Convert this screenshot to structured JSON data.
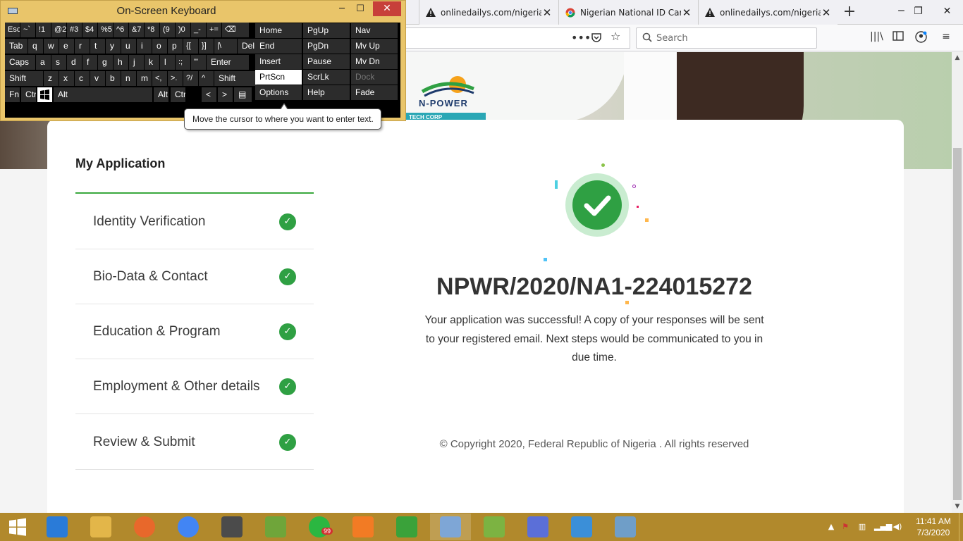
{
  "browser": {
    "tabs": [
      {
        "title": "onlinedailys.com/nigerian",
        "icon": "warning-icon"
      },
      {
        "title": "Nigerian National ID Card",
        "icon": "chrome-favicon-icon"
      },
      {
        "title": "onlinedailys.com/nigerian",
        "icon": "warning-icon"
      }
    ],
    "new_tab_label": "+",
    "search_placeholder": "Search",
    "window_controls": {
      "minimize": "─",
      "maximize": "❐",
      "close": "✕"
    }
  },
  "hero": {
    "logo_text": "N-POWER",
    "banner_text": "TECH CORP"
  },
  "application": {
    "title": "My Application",
    "steps": [
      {
        "label": "Identity Verification",
        "status": "✓"
      },
      {
        "label": "Bio-Data & Contact",
        "status": "✓"
      },
      {
        "label": "Education & Program",
        "status": "✓"
      },
      {
        "label": "Employment & Other details",
        "status": "✓"
      },
      {
        "label": "Review & Submit",
        "status": "✓"
      }
    ],
    "reference": "NPWR/2020/NA1-224015272",
    "message": "Your application was successful! A copy of your responses will be sent to your registered email. Next steps would be communicated to you in due time.",
    "copyright": "© Copyright 2020, Federal Republic of Nigeria . All rights reserved"
  },
  "osk": {
    "title": "On-Screen Keyboard",
    "tooltip": "Move the cursor to where you want to enter text.",
    "close": "✕",
    "minimize": "─",
    "maximize": "☐",
    "row1": [
      "Esc",
      "~`",
      "!1",
      "@2",
      "#3",
      "$4",
      "%5",
      "^6",
      "&7",
      "*8",
      "(9",
      ")0",
      "_-",
      "+=",
      "⌫"
    ],
    "row2": [
      "Tab",
      "q",
      "w",
      "e",
      "r",
      "t",
      "y",
      "u",
      "i",
      "o",
      "p",
      "{[",
      "}]",
      "|\\",
      "Del"
    ],
    "row3": [
      "Caps",
      "a",
      "s",
      "d",
      "f",
      "g",
      "h",
      "j",
      "k",
      "l",
      ":;",
      "\"'",
      "Enter"
    ],
    "row4": [
      "Shift",
      "z",
      "x",
      "c",
      "v",
      "b",
      "n",
      "m",
      "<,",
      ">.",
      "?/",
      "^",
      "Shift"
    ],
    "row5": [
      "Fn",
      "Ctrl",
      "Alt",
      "Alt",
      "Ctrl",
      "<",
      ">",
      "▤"
    ],
    "nav": [
      "Home",
      "PgUp",
      "Nav",
      "End",
      "PgDn",
      "Mv Up",
      "Insert",
      "Pause",
      "Mv Dn",
      "PrtScn",
      "ScrLk",
      "Dock",
      "Options",
      "Help",
      "Fade"
    ]
  },
  "taskbar": {
    "apps": [
      "Internet Explorer",
      "File Explorer",
      "Firefox",
      "Chrome",
      "Sublime Text",
      "Notepad",
      "WhatsApp",
      "XAMPP",
      "Greenshot",
      "On-Screen Keyboard",
      "App",
      "Settings",
      "Media Player",
      "Photos"
    ],
    "whatsapp_badge": "99",
    "time": "11:41 AM",
    "date": "7/3/2020"
  },
  "colors": {
    "accent_green": "#2fa043",
    "osk_frame": "#e9c56a",
    "taskbar": "#b1892c"
  }
}
